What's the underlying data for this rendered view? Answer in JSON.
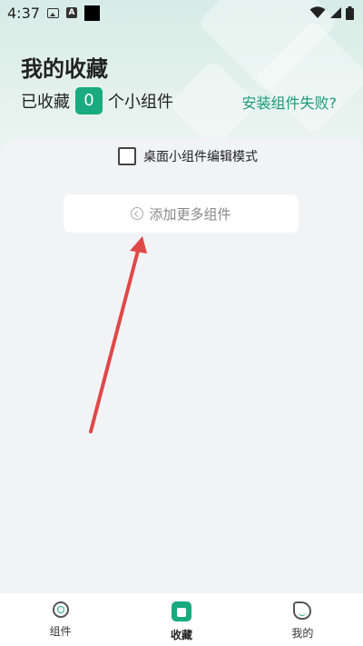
{
  "status_bar": {
    "time": "4:37",
    "left_icons": [
      "image-icon",
      "a-icon",
      "black-square-icon"
    ],
    "right_icons": [
      "wifi-icon",
      "signal-icon",
      "battery-icon"
    ]
  },
  "header": {
    "title": "我的收藏",
    "count_prefix": "已收藏",
    "count": "0",
    "count_suffix": "个小组件",
    "install_fail_link": "安装组件失败?"
  },
  "panel": {
    "edit_mode_label": "桌面小组件编辑模式",
    "edit_mode_checked": false,
    "add_more_label": "添加更多组件"
  },
  "bottom_nav": {
    "items": [
      {
        "label": "组件",
        "icon": "widget-icon",
        "active": false
      },
      {
        "label": "收藏",
        "icon": "favorites-icon",
        "active": true
      },
      {
        "label": "我的",
        "icon": "profile-icon",
        "active": false
      }
    ]
  },
  "colors": {
    "accent": "#1aaa7f",
    "link": "#1a9a72",
    "annotation_arrow": "#e04848",
    "header_bg": "#d7ece6",
    "panel_bg": "#f2f3f5"
  }
}
